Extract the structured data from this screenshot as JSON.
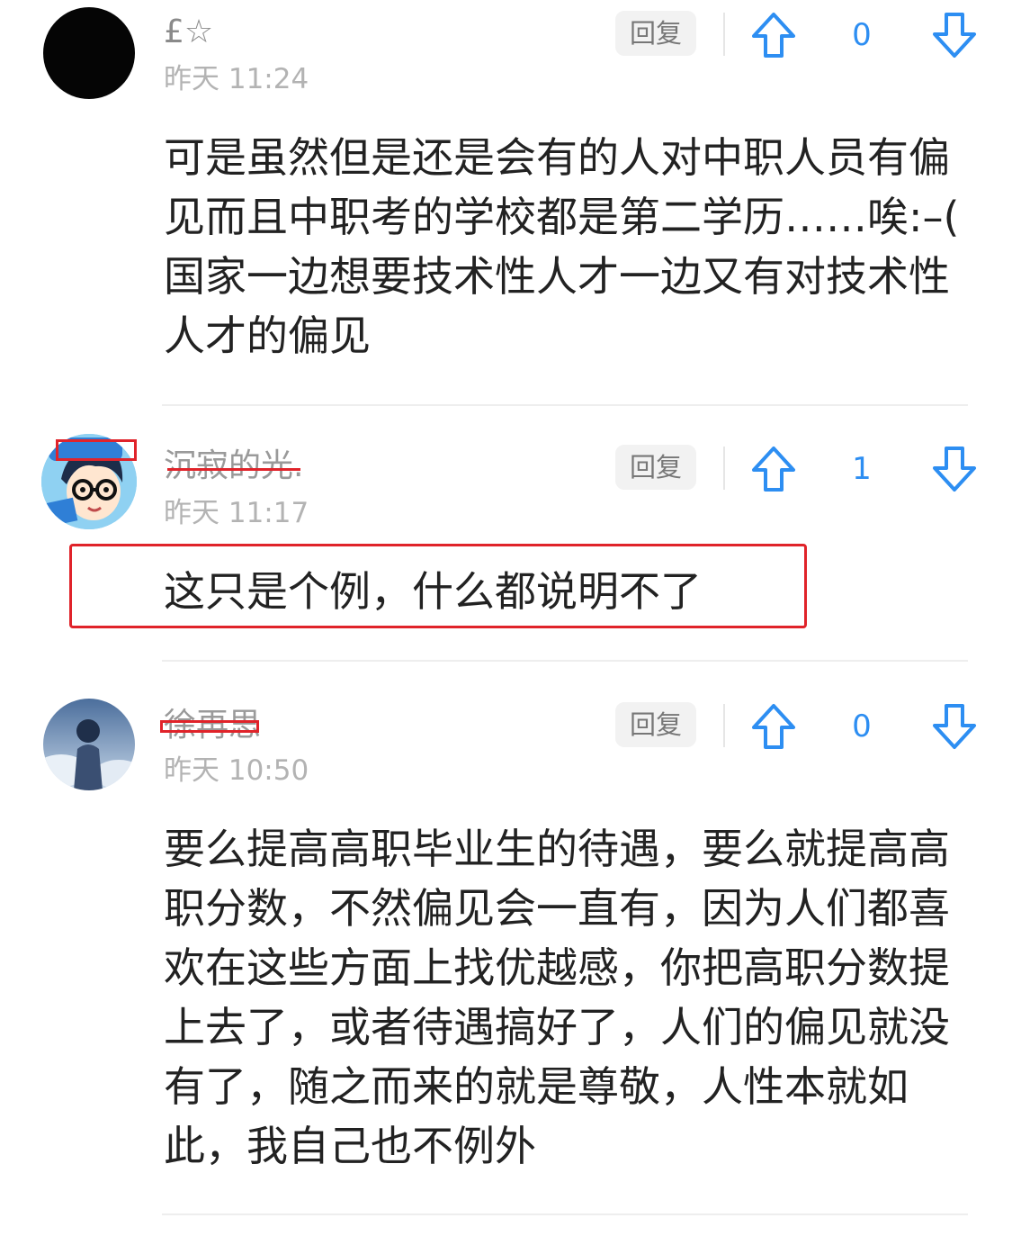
{
  "colors": {
    "accent": "#2d8ef2",
    "annotation_red": "#e0232a",
    "timestamp_gray": "#b3b3b3"
  },
  "comments": [
    {
      "username": "£☆",
      "timestamp": "昨天 11:24",
      "reply_label": "回复",
      "votes": "0",
      "text": "可是虽然但是还是会有的人对中职人员有偏见而且中职考的学校都是第二学历……唉:–( 国家一边想要技术性人才一边又有对技术性人才的偏见",
      "avatar": "black-circle-avatar"
    },
    {
      "username": "沉寂的光.",
      "timestamp": "昨天 11:17",
      "reply_label": "回复",
      "votes": "1",
      "text": "这只是个例，什么都说明不了",
      "avatar": "cartoon-boy-glasses-avatar"
    },
    {
      "username": "徐再思",
      "timestamp": "昨天 10:50",
      "reply_label": "回复",
      "votes": "0",
      "text": "要么提高高职毕业生的待遇，要么就提高高职分数，不然偏见会一直有，因为人们都喜欢在这些方面上找优越感，你把高职分数提上去了，或者待遇搞好了，人们的偏见就没有了，随之而来的就是尊敬，人性本就如此，我自己也不例外",
      "avatar": "anime-figure-sky-avatar"
    }
  ],
  "icons": {
    "upvote": "arrow-up-icon",
    "downvote": "arrow-down-icon"
  }
}
